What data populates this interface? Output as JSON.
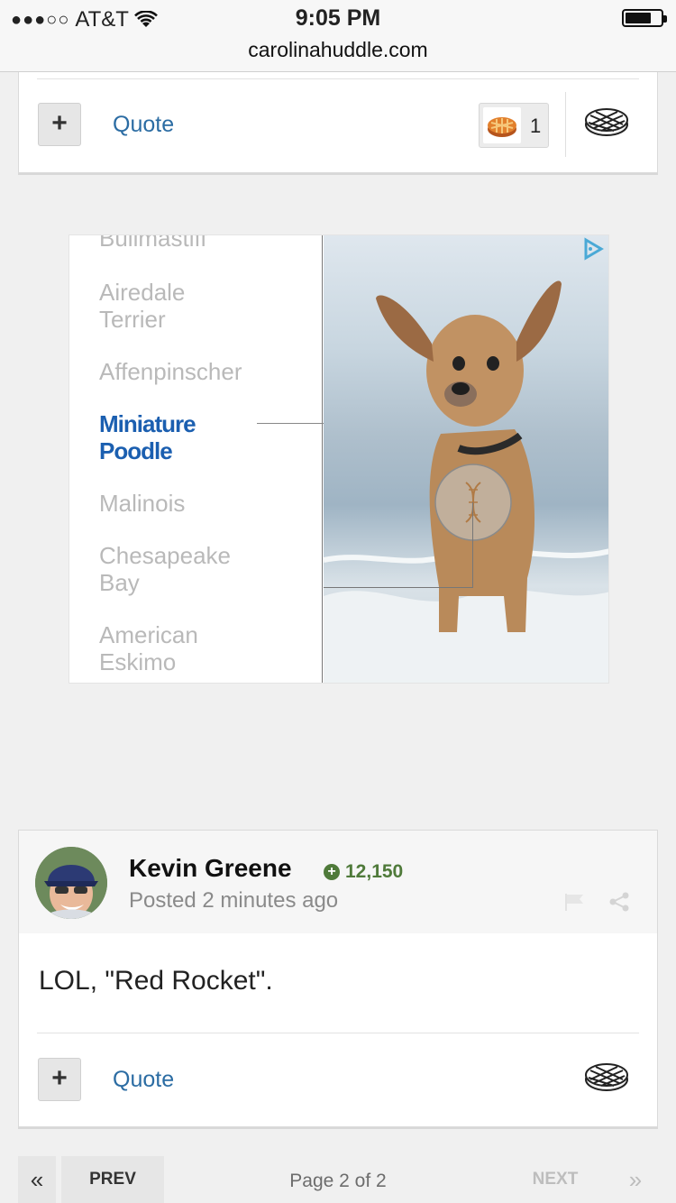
{
  "status_bar": {
    "signal_dots": "●●●○○",
    "carrier": "AT&T",
    "time": "9:05 PM",
    "url": "carolinahuddle.com"
  },
  "top_post_footer": {
    "plus_label": "+",
    "quote_label": "Quote",
    "reaction_count": "1"
  },
  "ad": {
    "breeds": [
      "Bullmastiff",
      "Airedale Terrier",
      "Affenpinscher",
      "Miniature Poodle",
      "Malinois",
      "Chesapeake Bay",
      "American Eskimo"
    ],
    "active_breed": "Miniature Poodle"
  },
  "post": {
    "author": "Kevin Greene",
    "reputation": "12,150",
    "posted": "Posted 2 minutes ago",
    "body": "LOL, \"Red Rocket\".",
    "plus_label": "+",
    "quote_label": "Quote"
  },
  "pagination": {
    "first": "«",
    "prev": "PREV",
    "page_label": "Page 2 of 2",
    "next": "NEXT",
    "last": "»"
  },
  "colors": {
    "link": "#2b6ca3",
    "reputation": "#4f7a3a",
    "active_breed": "#1b5fb0"
  }
}
